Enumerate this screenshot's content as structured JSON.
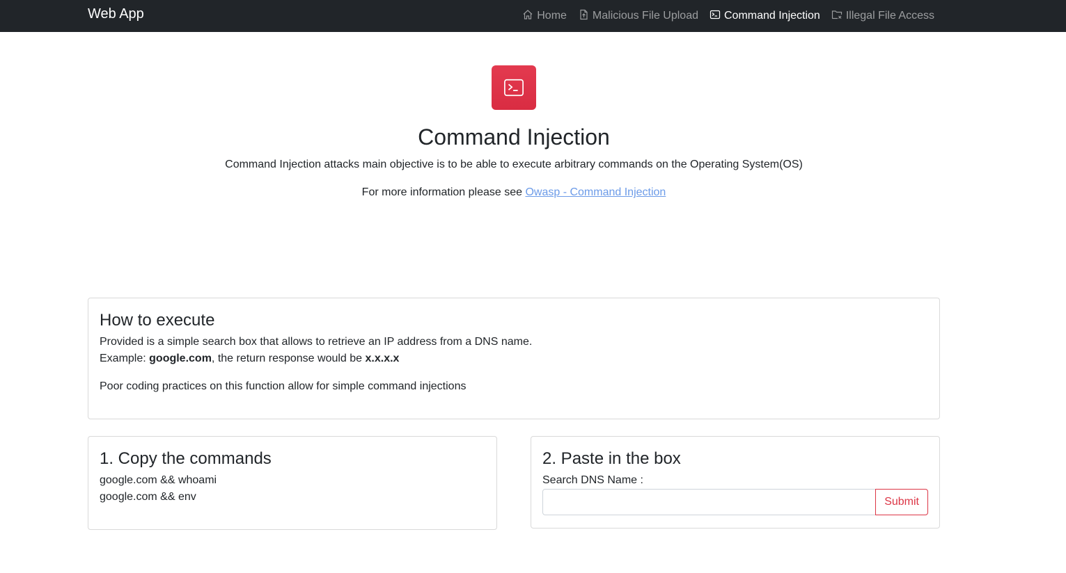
{
  "navbar": {
    "brand": "Web App",
    "items": [
      {
        "label": "Home",
        "icon": "house-icon",
        "active": false
      },
      {
        "label": "Malicious File Upload",
        "icon": "file-upload-icon",
        "active": false
      },
      {
        "label": "Command Injection",
        "icon": "terminal-icon",
        "active": true
      },
      {
        "label": "Illegal File Access",
        "icon": "folder-x-icon",
        "active": false
      }
    ]
  },
  "hero": {
    "icon": "terminal-icon",
    "title": "Command Injection",
    "description": "Command Injection attacks main objective is to be able to execute arbitrary commands on the Operating System(OS)",
    "more_prefix": "For more information please see ",
    "more_link": "Owasp - Command Injection"
  },
  "how": {
    "title": "How to execute",
    "line1": "Provided is a simple search box that allows to retrieve an IP address from a DNS name.",
    "example_prefix": "Example: ",
    "example_domain": "google.com",
    "example_middle": ", the return response would be ",
    "example_result": "x.x.x.x",
    "line3": "Poor coding practices on this function allow for simple command injections"
  },
  "copy": {
    "title": "1. Copy the commands",
    "commands": [
      "google.com && whoami",
      "google.com && env"
    ]
  },
  "paste": {
    "title": "2. Paste in the box",
    "label": "Search DNS Name :",
    "input_value": "",
    "submit_label": "Submit"
  },
  "colors": {
    "navbar_bg": "#212529",
    "accent_red": "#dc3545",
    "link_blue": "#6c9be8"
  }
}
